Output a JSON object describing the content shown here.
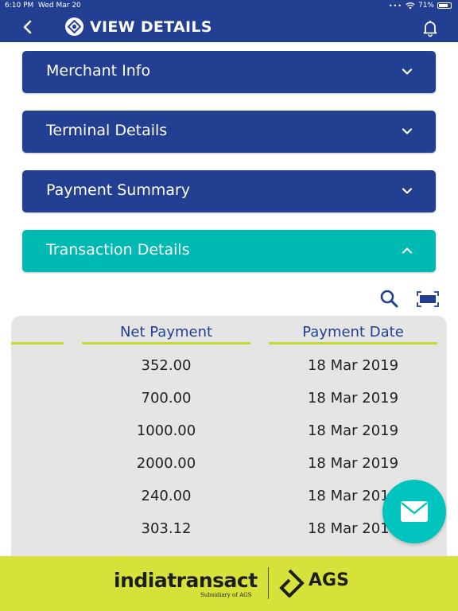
{
  "status": {
    "time": "6:10 PM",
    "date": "Wed Mar 20",
    "battery": "71%",
    "dots": "•••"
  },
  "header": {
    "title": "VIEW DETAILS"
  },
  "sections": [
    {
      "label": "Merchant Info"
    },
    {
      "label": "Terminal Details"
    },
    {
      "label": "Payment Summary"
    },
    {
      "label": "Transaction Details"
    }
  ],
  "table": {
    "columns": [
      "Net Payment",
      "Payment Date"
    ],
    "rows": [
      {
        "net_payment": "352.00",
        "payment_date": "18 Mar 2019"
      },
      {
        "net_payment": "700.00",
        "payment_date": "18 Mar 2019"
      },
      {
        "net_payment": "1000.00",
        "payment_date": "18 Mar 2019"
      },
      {
        "net_payment": "2000.00",
        "payment_date": "18 Mar 2019"
      },
      {
        "net_payment": "240.00",
        "payment_date": "18 Mar 2019"
      },
      {
        "net_payment": "303.12",
        "payment_date": "18 Mar 2019"
      }
    ]
  },
  "footer": {
    "brand": "indiatransact",
    "tagline": "Subsidiary of AGS",
    "partner": "AGS"
  },
  "colors": {
    "header": "#233f91",
    "active_section": "#00b9b2",
    "accent_line": "#c6d92f",
    "footer": "#d6e23a",
    "fab": "#00c4bd"
  },
  "icons": [
    "back-icon",
    "app-logo-icon",
    "bell-icon",
    "chevron-down-icon",
    "chevron-up-icon",
    "search-icon",
    "expand-icon",
    "mail-icon",
    "ags-logo-icon"
  ]
}
